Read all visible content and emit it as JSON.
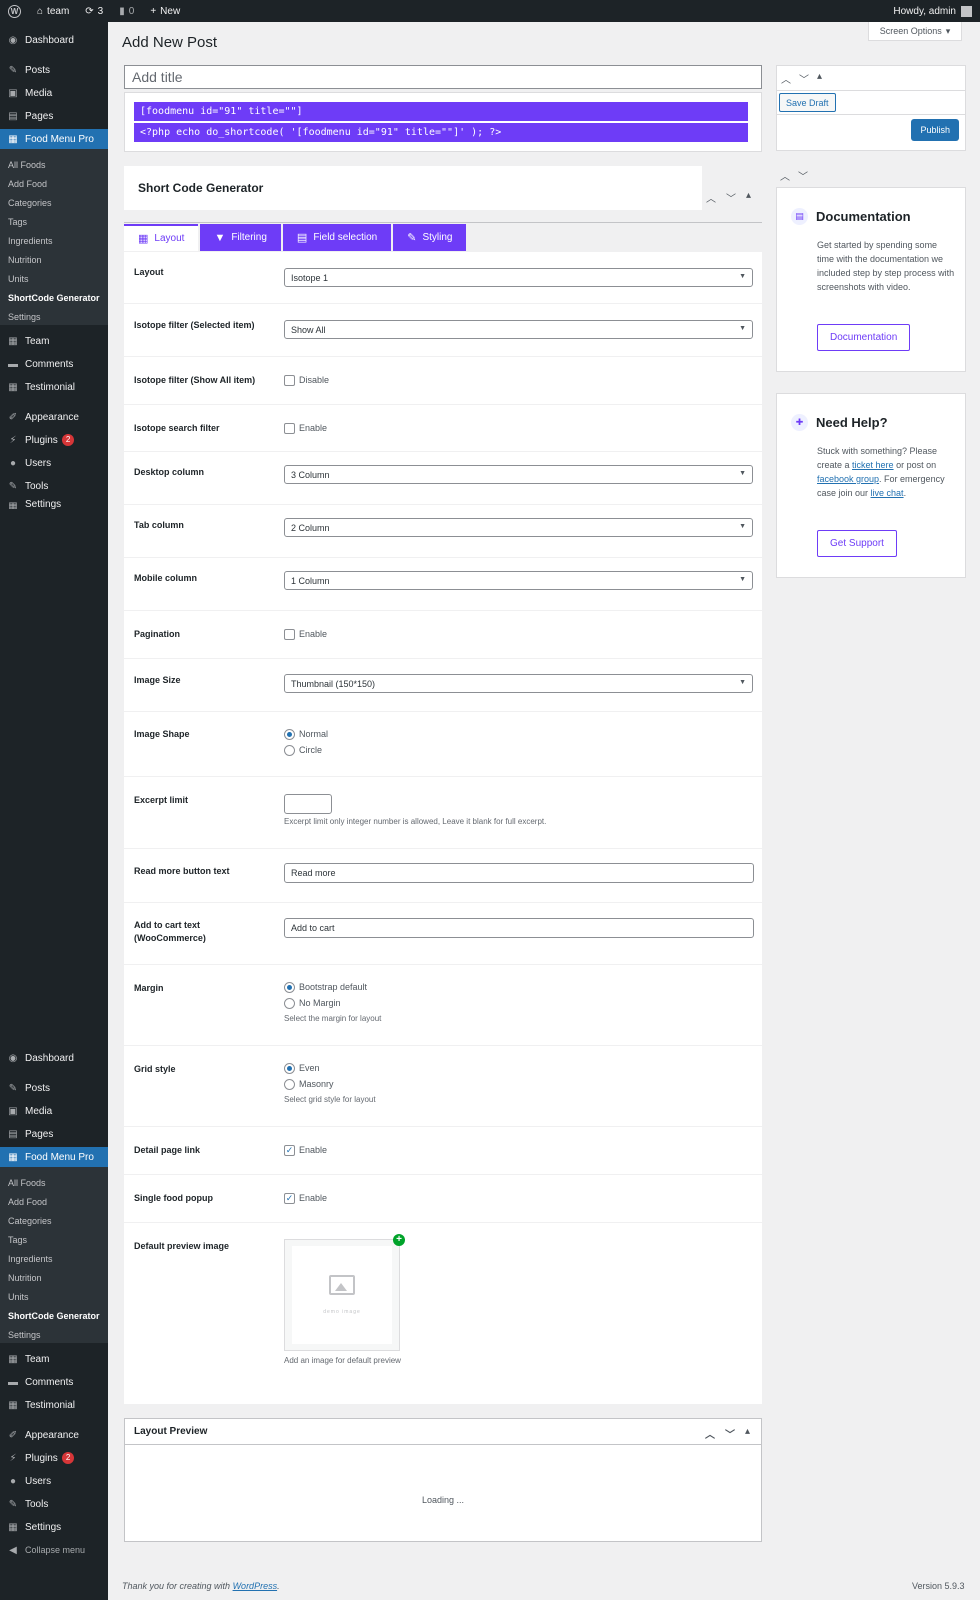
{
  "adminbar": {
    "site_name": "team",
    "updates_count": "3",
    "comments_count": "0",
    "new_label": "New",
    "howdy": "Howdy, admin"
  },
  "menu": {
    "dashboard": "Dashboard",
    "posts": "Posts",
    "media": "Media",
    "pages": "Pages",
    "food_menu_pro": "Food Menu Pro",
    "sub": {
      "all_foods": "All Foods",
      "add_food": "Add Food",
      "categories": "Categories",
      "tags": "Tags",
      "ingredients": "Ingredients",
      "nutrition": "Nutrition",
      "units": "Units",
      "shortcode_generator": "ShortCode Generator",
      "settings": "Settings"
    },
    "team": "Team",
    "comments": "Comments",
    "testimonial": "Testimonial",
    "appearance": "Appearance",
    "plugins": "Plugins",
    "plugins_badge": "2",
    "users": "Users",
    "tools": "Tools",
    "settings": "Settings",
    "collapse": "Collapse menu"
  },
  "page": {
    "title": "Add New Post",
    "screen_options": "Screen Options",
    "title_placeholder": "Add title",
    "shortcode_1": "[foodmenu id=\"91\" title=\"\"]",
    "shortcode_2": "<?php echo do_shortcode( '[foodmenu id=\"91\" title=\"\"]' ); ?>",
    "generator_title": "Short Code Generator"
  },
  "tabs": {
    "layout": "Layout",
    "filtering": "Filtering",
    "field_selection": "Field selection",
    "styling": "Styling"
  },
  "settings": {
    "layout": {
      "label": "Layout",
      "value": "Isotope 1"
    },
    "isotope_selected": {
      "label": "Isotope filter (Selected item)",
      "value": "Show All"
    },
    "isotope_show_all": {
      "label": "Isotope filter (Show All item)",
      "option": "Disable"
    },
    "isotope_search": {
      "label": "Isotope search filter",
      "option": "Enable"
    },
    "desktop_column": {
      "label": "Desktop column",
      "value": "3 Column"
    },
    "tab_column": {
      "label": "Tab column",
      "value": "2 Column"
    },
    "mobile_column": {
      "label": "Mobile column",
      "value": "1 Column"
    },
    "pagination": {
      "label": "Pagination",
      "option": "Enable"
    },
    "image_size": {
      "label": "Image Size",
      "value": "Thumbnail (150*150)"
    },
    "image_shape": {
      "label": "Image Shape",
      "opt1": "Normal",
      "opt2": "Circle"
    },
    "excerpt_limit": {
      "label": "Excerpt limit",
      "hint": "Excerpt limit only integer number is allowed, Leave it blank for full excerpt."
    },
    "read_more": {
      "label": "Read more button text",
      "value": "Read more"
    },
    "add_to_cart": {
      "label": "Add to cart text (WooCommerce)",
      "value": "Add to cart"
    },
    "margin": {
      "label": "Margin",
      "opt1": "Bootstrap default",
      "opt2": "No Margin",
      "hint": "Select the margin for layout"
    },
    "grid_style": {
      "label": "Grid style",
      "opt1": "Even",
      "opt2": "Masonry",
      "hint": "Select grid style for layout"
    },
    "detail_link": {
      "label": "Detail page link",
      "option": "Enable"
    },
    "single_popup": {
      "label": "Single food popup",
      "option": "Enable"
    },
    "default_image": {
      "label": "Default preview image",
      "hint": "Add an image for default preview",
      "placeholder_caption": "demo  image"
    }
  },
  "preview": {
    "title": "Layout Preview",
    "loading": "Loading ..."
  },
  "publish": {
    "save_draft": "Save Draft",
    "publish": "Publish"
  },
  "documentation": {
    "title": "Documentation",
    "text": "Get started by spending some time with the documentation we included step by step process with screenshots with video.",
    "button": "Documentation"
  },
  "help": {
    "title": "Need Help?",
    "text_1": "Stuck with something? Please create a ",
    "link_ticket": "ticket here",
    "text_2": " or post on ",
    "link_facebook": "facebook group",
    "text_3": ". For emergency case join our ",
    "link_chat": "live chat",
    "text_4": ".",
    "button": "Get Support"
  },
  "footer": {
    "thanks": "Thank you for creating with ",
    "wp_link": "WordPress",
    "thanks_end": ".",
    "version": "Version 5.9.3"
  },
  "colors": {
    "accent": "#6e3cf7",
    "wp_blue": "#2271b1",
    "admin_dark": "#1d2327"
  }
}
